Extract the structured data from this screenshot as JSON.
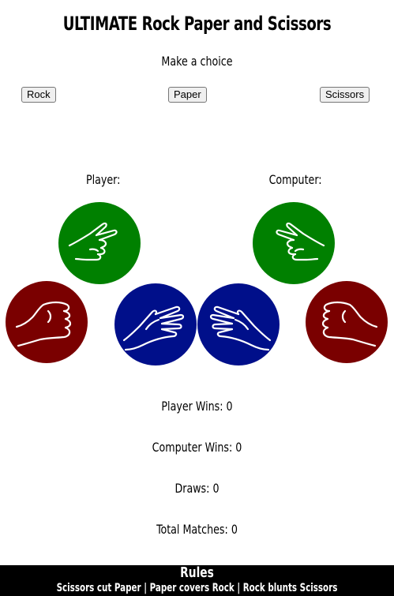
{
  "header": {
    "title": "ULTIMATE Rock Paper and Scissors",
    "subtitle": "Make a choice"
  },
  "choices": {
    "rock": "Rock",
    "paper": "Paper",
    "scissors": "Scissors"
  },
  "sides": {
    "player": "Player:",
    "computer": "Computer:"
  },
  "colors": {
    "rock": "#7a0000",
    "paper": "#000f8a",
    "scissors": "#008000"
  },
  "stats": {
    "player_wins": "Player Wins: 0",
    "computer_wins": "Computer Wins: 0",
    "draws": "Draws: 0",
    "total_matches": "Total Matches: 0"
  },
  "rules": {
    "title": "Rules",
    "text": "Scissors cut Paper | Paper covers Rock | Rock blunts Scissors"
  }
}
